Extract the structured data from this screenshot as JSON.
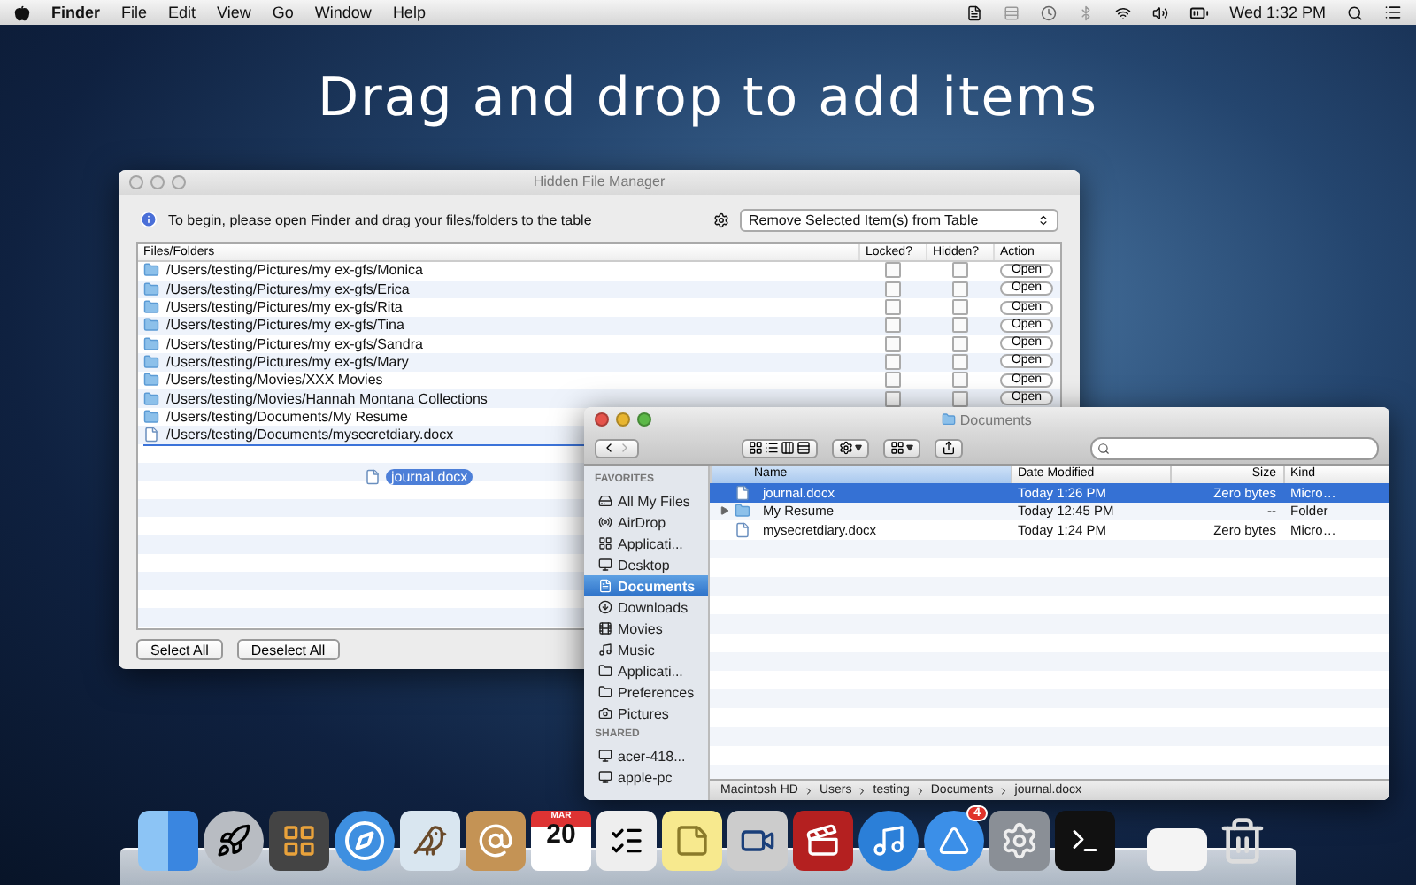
{
  "menubar": {
    "app_name": "Finder",
    "menus": [
      "File",
      "Edit",
      "View",
      "Go",
      "Window",
      "Help"
    ],
    "clock": "Wed 1:32 PM"
  },
  "headline": "Drag and drop to add items",
  "hidden_file_manager": {
    "title": "Hidden File Manager",
    "info": "To begin, please open Finder and drag your files/folders to the table",
    "action_select": "Remove Selected Item(s) from Table",
    "columns": [
      "Files/Folders",
      "Locked?",
      "Hidden?",
      "Action"
    ],
    "rows": [
      {
        "kind": "folder",
        "path": "/Users/testing/Pictures/my ex-gfs/Monica",
        "locked": false,
        "hidden": false,
        "action": "Open"
      },
      {
        "kind": "folder",
        "path": "/Users/testing/Pictures/my ex-gfs/Erica",
        "locked": false,
        "hidden": false,
        "action": "Open"
      },
      {
        "kind": "folder",
        "path": "/Users/testing/Pictures/my ex-gfs/Rita",
        "locked": false,
        "hidden": false,
        "action": "Open"
      },
      {
        "kind": "folder",
        "path": "/Users/testing/Pictures/my ex-gfs/Tina",
        "locked": false,
        "hidden": false,
        "action": "Open"
      },
      {
        "kind": "folder",
        "path": "/Users/testing/Pictures/my ex-gfs/Sandra",
        "locked": false,
        "hidden": false,
        "action": "Open"
      },
      {
        "kind": "folder",
        "path": "/Users/testing/Pictures/my ex-gfs/Mary",
        "locked": false,
        "hidden": false,
        "action": "Open"
      },
      {
        "kind": "folder",
        "path": "/Users/testing/Movies/XXX Movies",
        "locked": false,
        "hidden": false,
        "action": "Open"
      },
      {
        "kind": "folder",
        "path": "/Users/testing/Movies/Hannah Montana Collections",
        "locked": false,
        "hidden": false,
        "action": "Open"
      },
      {
        "kind": "folder",
        "path": "/Users/testing/Documents/My Resume"
      },
      {
        "kind": "document",
        "path": "/Users/testing/Documents/mysecretdiary.docx"
      }
    ],
    "drag_item": "journal.docx",
    "buttons": [
      "Select All",
      "Deselect All"
    ]
  },
  "finder": {
    "title": "Documents",
    "sidebar": [
      {
        "kind": "heading",
        "label": "FAVORITES"
      },
      {
        "kind": "item",
        "label": "All My Files",
        "selected": false
      },
      {
        "kind": "item",
        "label": "AirDrop",
        "selected": false
      },
      {
        "kind": "item",
        "label": "Applicati...",
        "selected": false
      },
      {
        "kind": "item",
        "label": "Desktop",
        "selected": false
      },
      {
        "kind": "item",
        "label": "Documents",
        "selected": true
      },
      {
        "kind": "item",
        "label": "Downloads",
        "selected": false
      },
      {
        "kind": "item",
        "label": "Movies",
        "selected": false
      },
      {
        "kind": "item",
        "label": "Music",
        "selected": false
      },
      {
        "kind": "item",
        "label": "Applicati...",
        "selected": false
      },
      {
        "kind": "item",
        "label": "Preferences",
        "selected": false
      },
      {
        "kind": "item",
        "label": "Pictures",
        "selected": false
      },
      {
        "kind": "heading",
        "label": "SHARED"
      },
      {
        "kind": "item",
        "label": "acer-418...",
        "selected": false
      },
      {
        "kind": "item",
        "label": "apple-pc",
        "selected": false
      }
    ],
    "columns": [
      "Name",
      "Date Modified",
      "Size",
      "Kind"
    ],
    "files": [
      {
        "kind": "document",
        "name": "journal.docx",
        "date": "Today 1:26 PM",
        "size": "Zero bytes",
        "type": "Micro…",
        "selected": true
      },
      {
        "kind": "folder",
        "name": "My Resume",
        "date": "Today 12:45 PM",
        "size": "--",
        "type": "Folder",
        "selected": false
      },
      {
        "kind": "document",
        "name": "mysecretdiary.docx",
        "date": "Today 1:24 PM",
        "size": "Zero bytes",
        "type": "Micro…",
        "selected": false
      }
    ],
    "path": [
      "Macintosh HD",
      "Users",
      "testing",
      "Documents",
      "journal.docx"
    ]
  },
  "dock": {
    "calendar_month": "MAR",
    "calendar_day": "20",
    "app_store_badge": "4"
  }
}
